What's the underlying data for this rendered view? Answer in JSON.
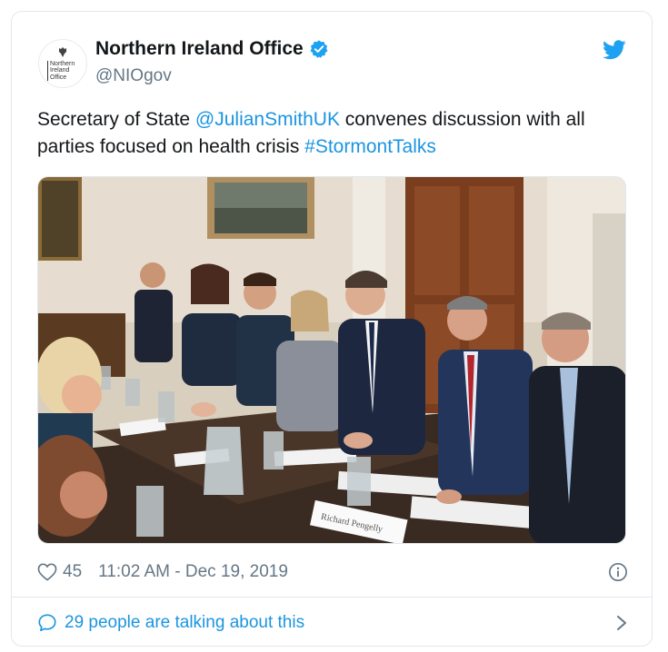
{
  "account": {
    "display_name": "Northern Ireland Office",
    "handle": "@NIOgov",
    "avatar_text": [
      "Northern",
      "Ireland",
      "Office"
    ],
    "verified": true
  },
  "tweet": {
    "text_prefix": "Secretary of State ",
    "mention": "@JulianSmithUK",
    "text_middle": " convenes discussion with all parties focused on health crisis ",
    "hashtag": "#StormontTalks"
  },
  "photo": {
    "icon": "photo-image",
    "place_cards": [
      "Richard Pengelly"
    ]
  },
  "stats": {
    "likes": "45",
    "timestamp": "11:02 AM - Dec 19, 2019"
  },
  "conversation": {
    "label": "29 people are talking about this"
  },
  "icons": {
    "verified": "verified-badge-icon",
    "bird": "twitter-bird-icon",
    "heart": "heart-icon",
    "info": "info-icon",
    "bubble": "speech-bubble-icon",
    "chevron": "chevron-right-icon"
  },
  "colors": {
    "link": "#1b95e0",
    "muted": "#657786",
    "border": "#e1e8ed",
    "twitter_blue": "#1da1f2"
  }
}
